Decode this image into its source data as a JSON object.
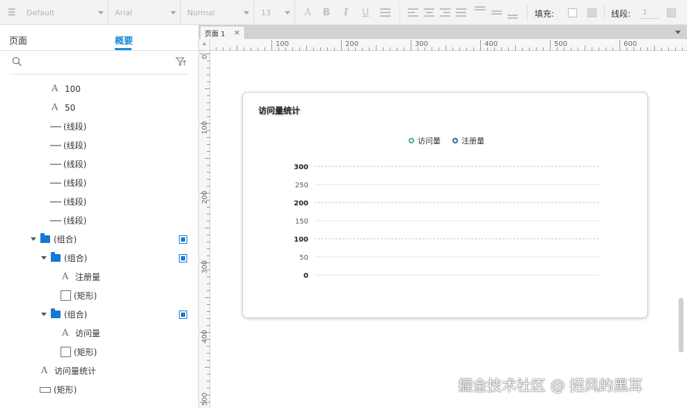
{
  "toolbar": {
    "style_select": "Default",
    "font_select": "Arial",
    "weight_select": "Normal",
    "size_select": "13",
    "icons": [
      "font-color-icon",
      "bold-icon",
      "italic-icon",
      "bullets-icon",
      "align-left-icon",
      "align-center-icon",
      "align-right-icon",
      "justify-icon",
      "valign-top-icon",
      "valign-middle-icon",
      "valign-bottom-icon"
    ],
    "fill_label": "填充:",
    "line_label": "线段:",
    "line_value": "1"
  },
  "left_panel": {
    "tabs": [
      {
        "label": "页面",
        "active": false
      },
      {
        "label": "概要",
        "active": true
      }
    ],
    "accent_color": "#1c8ad7",
    "items": [
      {
        "label": "100",
        "icon": "text-icon",
        "indent": 1
      },
      {
        "label": "50",
        "icon": "text-icon",
        "indent": 1
      },
      {
        "label": "(线段)",
        "icon": "line-icon",
        "indent": 1
      },
      {
        "label": "(线段)",
        "icon": "line-icon",
        "indent": 1
      },
      {
        "label": "(线段)",
        "icon": "line-icon",
        "indent": 1
      },
      {
        "label": "(线段)",
        "icon": "line-icon",
        "indent": 1
      },
      {
        "label": "(线段)",
        "icon": "line-icon",
        "indent": 1
      },
      {
        "label": "(线段)",
        "icon": "line-icon",
        "indent": 1
      },
      {
        "label": "(组合)",
        "icon": "folder-icon",
        "indent": 0,
        "expanded": true,
        "flag": true
      },
      {
        "label": "(组合)",
        "icon": "folder-icon",
        "indent": 1,
        "expanded": true,
        "flag": true
      },
      {
        "label": "注册量",
        "icon": "text-icon",
        "indent": 2
      },
      {
        "label": "(矩形)",
        "icon": "rect-icon",
        "indent": 2
      },
      {
        "label": "(组合)",
        "icon": "folder-icon",
        "indent": 1,
        "expanded": true,
        "flag": true
      },
      {
        "label": "访问量",
        "icon": "text-icon",
        "indent": 2
      },
      {
        "label": "(矩形)",
        "icon": "rect-icon",
        "indent": 2
      },
      {
        "label": "访问量统计",
        "icon": "text-icon",
        "indent": 0
      },
      {
        "label": "(矩形)",
        "icon": "rect-wide-icon",
        "indent": 0
      }
    ]
  },
  "canvas": {
    "tab_label": "页面 1",
    "h_ruler_labels": [
      "100",
      "200",
      "300",
      "400",
      "500",
      "600"
    ],
    "v_ruler_labels": [
      "0",
      "100",
      "200",
      "300",
      "400",
      "500"
    ]
  },
  "chart_data": {
    "type": "line",
    "title": "访问量统计",
    "series": [
      {
        "name": "访问量",
        "color": "#3db389",
        "values": []
      },
      {
        "name": "注册量",
        "color": "#2f6d8c",
        "values": []
      }
    ],
    "y_ticks": [
      300,
      250,
      200,
      150,
      100,
      50,
      0
    ],
    "ylim": [
      0,
      300
    ],
    "legend": "top-center",
    "grid": true
  },
  "watermark": "掘金技术社区 @ 招风的黑耳"
}
